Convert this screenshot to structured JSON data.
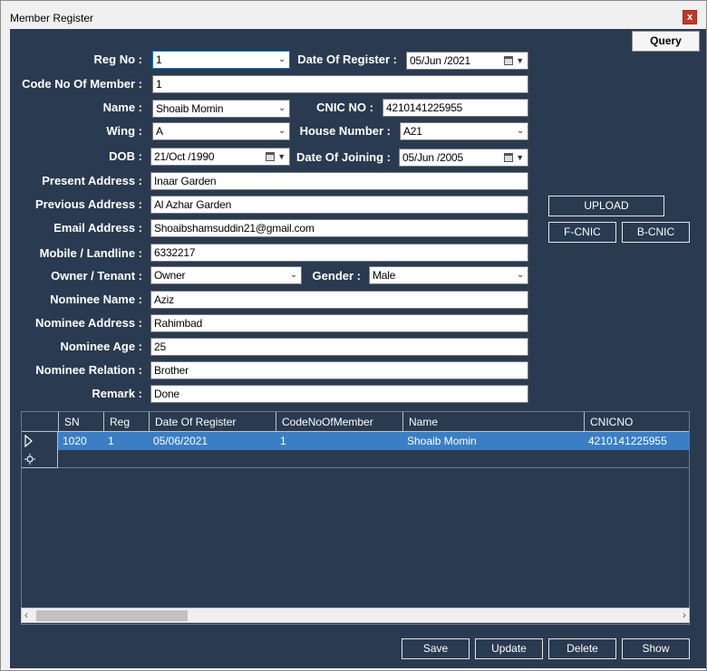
{
  "window": {
    "title": "Member Register",
    "close_glyph": "x"
  },
  "buttons": {
    "query": "Query",
    "upload": "UPLOAD",
    "fcnic": "F-CNIC",
    "bcnic": "B-CNIC",
    "save": "Save",
    "update": "Update",
    "delete": "Delete",
    "show": "Show"
  },
  "form": {
    "reg_no": {
      "label": "Reg No :",
      "value": "1"
    },
    "date_of_register": {
      "label": "Date Of Register :",
      "value": "05/Jun /2021"
    },
    "code_no": {
      "label": "Code No Of Member :",
      "value": "1"
    },
    "name": {
      "label": "Name :",
      "value": "Shoaib Momin"
    },
    "cnic": {
      "label": "CNIC NO :",
      "value": "4210141225955"
    },
    "wing": {
      "label": "Wing :",
      "value": "A"
    },
    "house_number": {
      "label": "House Number :",
      "value": "A21"
    },
    "dob": {
      "label": "DOB :",
      "value": "21/Oct /1990"
    },
    "date_of_joining": {
      "label": "Date Of Joining :",
      "value": "05/Jun /2005"
    },
    "present_address": {
      "label": "Present Address :",
      "value": "Inaar Garden"
    },
    "previous_address": {
      "label": "Previous Address :",
      "value": "Al Azhar Garden"
    },
    "email": {
      "label": "Email Address :",
      "value": "Shoaibshamsuddin21@gmail.com"
    },
    "mobile": {
      "label": "Mobile / Landline :",
      "value": "6332217"
    },
    "owner_tenant": {
      "label": "Owner / Tenant :",
      "value": "Owner"
    },
    "gender": {
      "label": "Gender :",
      "value": "Male"
    },
    "nominee_name": {
      "label": "Nominee Name :",
      "value": "Aziz"
    },
    "nominee_address": {
      "label": "Nominee Address :",
      "value": "Rahimbad"
    },
    "nominee_age": {
      "label": "Nominee Age :",
      "value": "25"
    },
    "nominee_relation": {
      "label": "Nominee Relation :",
      "value": "Brother"
    },
    "remark": {
      "label": "Remark :",
      "value": "Done"
    }
  },
  "grid": {
    "columns": [
      "SN",
      "Reg",
      "Date Of Register",
      "CodeNoOfMember",
      "Name",
      "CNICNO"
    ],
    "rows": [
      [
        "1020",
        "1",
        "05/06/2021",
        "1",
        "Shoaib Momin",
        "4210141225955"
      ]
    ]
  },
  "icons": {
    "dropdown": "chevron-down-icon",
    "calendar": "calendar-icon",
    "current_row": "row-pointer-icon",
    "new_row": "new-row-icon"
  }
}
